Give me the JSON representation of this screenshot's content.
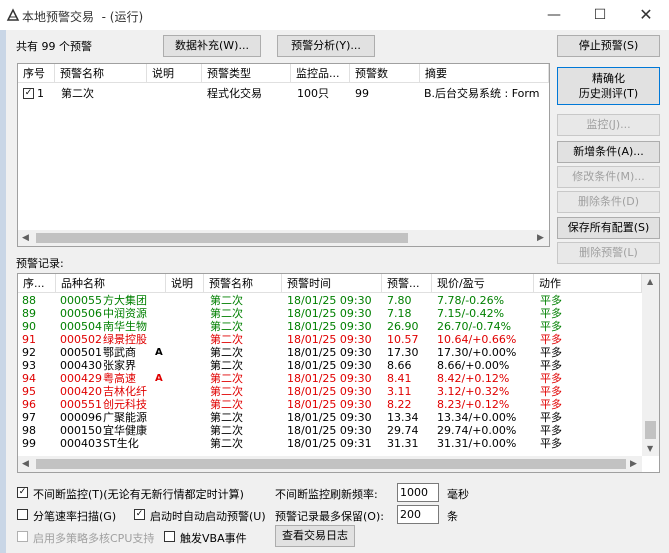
{
  "window": {
    "title": "本地预警交易  - (运行)"
  },
  "top": {
    "count_text": "共有 99 个预警",
    "data_supplement_btn": "数据补充(W)...",
    "analysis_btn": "预警分析(Y)...",
    "stop_btn": "停止预警(S)"
  },
  "alerts_table": {
    "headers": [
      "序号",
      "预警名称",
      "说明",
      "预警类型",
      "监控品...",
      "预警数",
      "摘要"
    ],
    "rows": [
      {
        "checked": "✓",
        "no": "1",
        "name": "第二次",
        "desc": "",
        "type": "程式化交易",
        "monitor": "100只",
        "count": "99",
        "summary": "B.后台交易系统 : Form"
      }
    ]
  },
  "right_buttons": {
    "fine_backtest_line1": "精确化",
    "fine_backtest_line2": "历史测评(T)",
    "monitor": "监控(J)...",
    "add_condition": "新增条件(A)...",
    "edit_condition": "修改条件(M)...",
    "delete_condition": "删除条件(D)",
    "save_all": "保存所有配置(S)",
    "delete_alert": "删除预警(L)"
  },
  "records": {
    "label": "预警记录:",
    "headers": [
      "序...",
      "品种名称",
      "说明",
      "预警名称",
      "预警时间",
      "预警...",
      "现价/盈亏",
      "动作"
    ],
    "rows": [
      {
        "no": "88",
        "code": "000055",
        "name": "方大集团",
        "mark": "",
        "alert": "第二次",
        "time": "18/01/25 09:30",
        "price": "7.80",
        "pnl": "7.78/-0.26%",
        "action": "平多",
        "color": "#008000"
      },
      {
        "no": "89",
        "code": "000506",
        "name": "中润资源",
        "mark": "",
        "alert": "第二次",
        "time": "18/01/25 09:30",
        "price": "7.18",
        "pnl": "7.15/-0.42%",
        "action": "平多",
        "color": "#008000"
      },
      {
        "no": "90",
        "code": "000504",
        "name": "南华生物",
        "mark": "",
        "alert": "第二次",
        "time": "18/01/25 09:30",
        "price": "26.90",
        "pnl": "26.70/-0.74%",
        "action": "平多",
        "color": "#008000"
      },
      {
        "no": "91",
        "code": "000502",
        "name": "绿景控股",
        "mark": "",
        "alert": "第二次",
        "time": "18/01/25 09:30",
        "price": "10.57",
        "pnl": "10.64/+0.66%",
        "action": "平多",
        "color": "#e00000"
      },
      {
        "no": "92",
        "code": "000501",
        "name": "鄂武商",
        "mark": "A",
        "alert": "第二次",
        "time": "18/01/25 09:30",
        "price": "17.30",
        "pnl": "17.30/+0.00%",
        "action": "平多",
        "color": "#000000"
      },
      {
        "no": "93",
        "code": "000430",
        "name": "张家界",
        "mark": "",
        "alert": "第二次",
        "time": "18/01/25 09:30",
        "price": "8.66",
        "pnl": "8.66/+0.00%",
        "action": "平多",
        "color": "#000000"
      },
      {
        "no": "94",
        "code": "000429",
        "name": "粤高速",
        "mark": "A",
        "alert": "第二次",
        "time": "18/01/25 09:30",
        "price": "8.41",
        "pnl": "8.42/+0.12%",
        "action": "平多",
        "color": "#e00000"
      },
      {
        "no": "95",
        "code": "000420",
        "name": "吉林化纤",
        "mark": "",
        "alert": "第二次",
        "time": "18/01/25 09:30",
        "price": "3.11",
        "pnl": "3.12/+0.32%",
        "action": "平多",
        "color": "#e00000"
      },
      {
        "no": "96",
        "code": "000551",
        "name": "创元科技",
        "mark": "",
        "alert": "第二次",
        "time": "18/01/25 09:30",
        "price": "8.22",
        "pnl": "8.23/+0.12%",
        "action": "平多",
        "color": "#e00000"
      },
      {
        "no": "97",
        "code": "000096",
        "name": "广聚能源",
        "mark": "",
        "alert": "第二次",
        "time": "18/01/25 09:30",
        "price": "13.34",
        "pnl": "13.34/+0.00%",
        "action": "平多",
        "color": "#000000"
      },
      {
        "no": "98",
        "code": "000150",
        "name": "宜华健康",
        "mark": "",
        "alert": "第二次",
        "time": "18/01/25 09:30",
        "price": "29.74",
        "pnl": "29.74/+0.00%",
        "action": "平多",
        "color": "#000000"
      },
      {
        "no": "99",
        "code": "000403",
        "name": "ST生化",
        "mark": "",
        "alert": "第二次",
        "time": "18/01/25 09:31",
        "price": "31.31",
        "pnl": "31.31/+0.00%",
        "action": "平多",
        "color": "#000000"
      }
    ]
  },
  "options": {
    "continuous_monitor": "不间断监控(T)(无论有无新行情都定时计算)",
    "refresh_label": "不间断监控刷新频率:",
    "refresh_value": "1000",
    "refresh_unit": "毫秒",
    "split_scan": "分笔速率扫描(G)",
    "auto_start": "启动时自动启动预警(U)",
    "max_records_label": "预警记录最多保留(O):",
    "max_records_value": "200",
    "max_records_unit": "条",
    "multi_cpu": "启用多策略多核CPU支持",
    "vba_event": "触发VBA事件",
    "view_log_btn": "查看交易日志",
    "check_mark": "✓"
  }
}
